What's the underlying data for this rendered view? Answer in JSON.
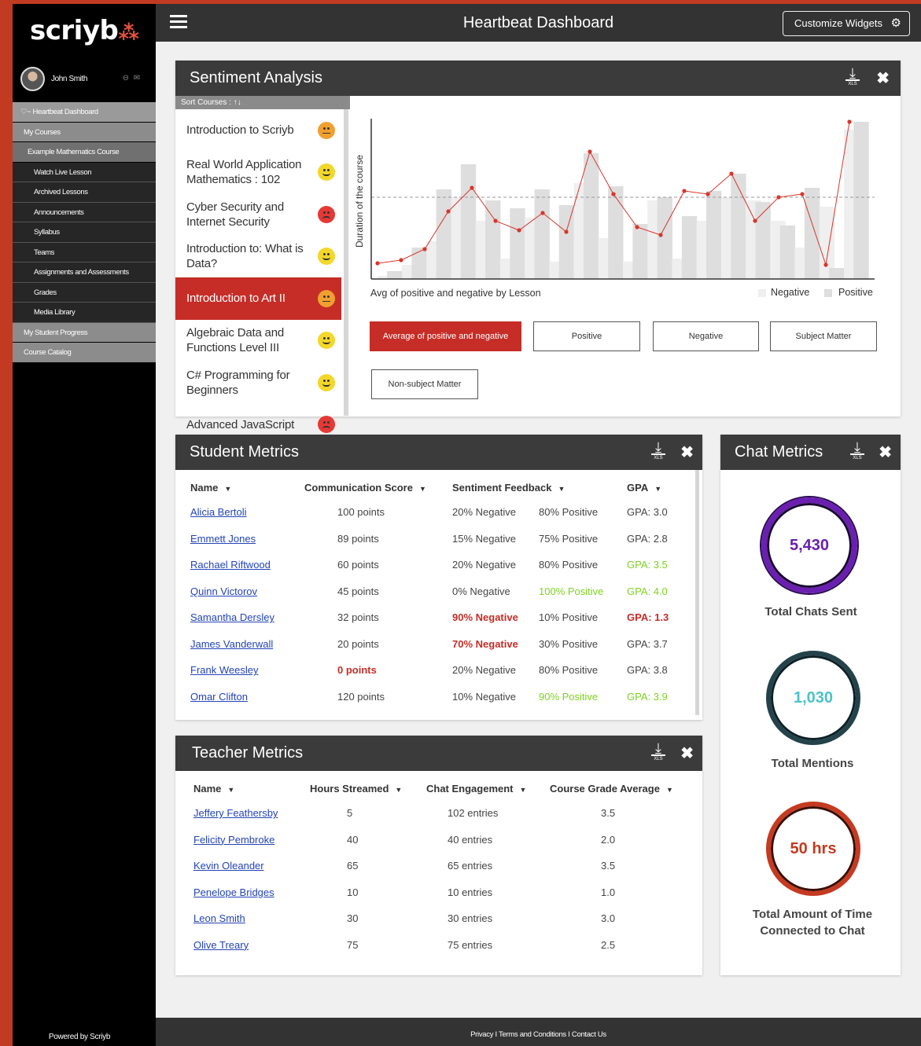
{
  "app": {
    "logo_text": "scriyb",
    "title": "Heartbeat Dashboard",
    "customize_label": "Customize Widgets",
    "footer": "Privacy I Terms and Conditions I Contact Us",
    "powered_by": "Powered by Scriyb"
  },
  "user": {
    "name": "John Smith"
  },
  "sidebar": {
    "items": [
      {
        "label": "Heartbeat Dashboard"
      },
      {
        "label": "My Courses"
      },
      {
        "label": "Example Mathematics Course"
      },
      {
        "label": "Watch Live Lesson"
      },
      {
        "label": "Archived Lessons"
      },
      {
        "label": "Announcements"
      },
      {
        "label": "Syllabus"
      },
      {
        "label": "Teams"
      },
      {
        "label": "Assignments and Assessments"
      },
      {
        "label": "Grades"
      },
      {
        "label": "Media Library"
      },
      {
        "label": "My Student Progress"
      },
      {
        "label": "Course Catalog"
      }
    ]
  },
  "sentiment": {
    "title": "Sentiment Analysis",
    "sort_label": "Sort Courses :",
    "sort_icon": "↑↓",
    "courses": [
      {
        "name": "Introduction to Scriyb",
        "mood": "neutral"
      },
      {
        "name": "Real World Application Mathematics : 102",
        "mood": "happy"
      },
      {
        "name": "Cyber Security and Internet Security",
        "mood": "sad"
      },
      {
        "name": "Introduction to: What is Data?",
        "mood": "happy"
      },
      {
        "name": "Introduction to Art II",
        "mood": "neutral"
      },
      {
        "name": "Algebraic Data and Functions Level III",
        "mood": "happy"
      },
      {
        "name": "C# Programming for Beginners",
        "mood": "happy"
      },
      {
        "name": "Advanced JavaScript",
        "mood": "sad"
      }
    ],
    "filters": [
      {
        "label": "Average of positive and negative"
      },
      {
        "label": "Positive"
      },
      {
        "label": "Negative"
      },
      {
        "label": "Subject Matter"
      },
      {
        "label": "Non-subject Matter"
      }
    ]
  },
  "chart_data": {
    "type": "bar",
    "title": "Avg of positive and negative by Lesson",
    "ylabel": "Duration of the course",
    "xlabel": "",
    "legend_placement": "bottom-right",
    "grid": false,
    "average_reference_line": 52,
    "series": [
      {
        "name": "Negative",
        "color": "#efefef",
        "values": [
          2,
          9,
          24,
          52,
          37,
          13,
          39,
          11,
          61,
          26,
          11,
          50,
          13,
          37,
          52,
          50,
          37,
          20,
          46,
          95
        ]
      },
      {
        "name": "Positive",
        "color": "#dedede",
        "values": [
          5,
          20,
          57,
          73,
          50,
          45,
          57,
          47,
          80,
          59,
          35,
          52,
          40,
          56,
          67,
          49,
          34,
          58,
          7,
          100
        ]
      }
    ],
    "line": {
      "name": "Average of positive and negative",
      "color": "#d9342b",
      "values": [
        10,
        12,
        19,
        43,
        58,
        37,
        31,
        42,
        30,
        81,
        54,
        33,
        28,
        56,
        54,
        67,
        37,
        52,
        54,
        9,
        100
      ]
    }
  },
  "student_metrics": {
    "title": "Student Metrics",
    "columns": [
      "Name",
      "Communication Score",
      "Sentiment Feedback",
      "GPA"
    ],
    "rows": [
      {
        "name": "Alicia Bertoli",
        "score": "100 points",
        "neg": "20% Negative",
        "pos": "80% Positive",
        "gpa": "GPA: 3.0"
      },
      {
        "name": "Emmett Jones",
        "score": "89 points",
        "neg": "15% Negative",
        "pos": "75% Positive",
        "gpa": "GPA: 2.8"
      },
      {
        "name": "Rachael Riftwood",
        "score": "60 points",
        "neg": "20% Negative",
        "pos": "80% Positive",
        "gpa": "GPA: 3.5"
      },
      {
        "name": "Quinn Victorov",
        "score": "45 points",
        "neg": "0% Negative",
        "pos": "100% Positive",
        "gpa": "GPA: 4.0"
      },
      {
        "name": "Samantha Dersley",
        "score": "32 points",
        "neg": "90% Negative",
        "pos": "10% Positive",
        "gpa": "GPA: 1.3"
      },
      {
        "name": "James Vanderwall",
        "score": "20 points",
        "neg": "70% Negative",
        "pos": "30% Positive",
        "gpa": "GPA: 3.7"
      },
      {
        "name": "Frank Weesley",
        "score": "0 points",
        "neg": "20% Negative",
        "pos": "80% Positive",
        "gpa": "GPA: 3.8"
      },
      {
        "name": "Omar Clifton",
        "score": "120 points",
        "neg": "10% Negative",
        "pos": "90% Positive",
        "gpa": "GPA: 3.9"
      }
    ]
  },
  "teacher_metrics": {
    "title": "Teacher Metrics",
    "columns": [
      "Name",
      "Hours Streamed",
      "Chat Engagement",
      "Course Grade Average"
    ],
    "rows": [
      {
        "name": "Jeffery Feathersby",
        "hours": "5",
        "chat": "102 entries",
        "grade": "3.5"
      },
      {
        "name": "Felicity Pembroke",
        "hours": "40",
        "chat": "40 entries",
        "grade": "2.0"
      },
      {
        "name": "Kevin Oleander",
        "hours": "65",
        "chat": "65 entries",
        "grade": "3.5"
      },
      {
        "name": "Penelope Bridges",
        "hours": "10",
        "chat": "10 entries",
        "grade": "1.0"
      },
      {
        "name": "Leon Smith",
        "hours": "30",
        "chat": "30 entries",
        "grade": "3.0"
      },
      {
        "name": "Olive Treary",
        "hours": "75",
        "chat": "75 entries",
        "grade": "2.5"
      }
    ]
  },
  "chat_metrics": {
    "title": "Chat Metrics",
    "stats": [
      {
        "value": "5,430",
        "label": "Total Chats Sent",
        "color": "#6a1fb0"
      },
      {
        "value": "1,030",
        "label": "Total Mentions",
        "color": "#4bc2c9"
      },
      {
        "value": "50 hrs",
        "label": "Total Amount of Time Connected to Chat",
        "color": "#c53a20"
      }
    ]
  },
  "colors": {
    "brand": "#c62d27",
    "link": "#2344b8",
    "good": "#7ed321",
    "bar_dark": "#3b3b3b"
  }
}
